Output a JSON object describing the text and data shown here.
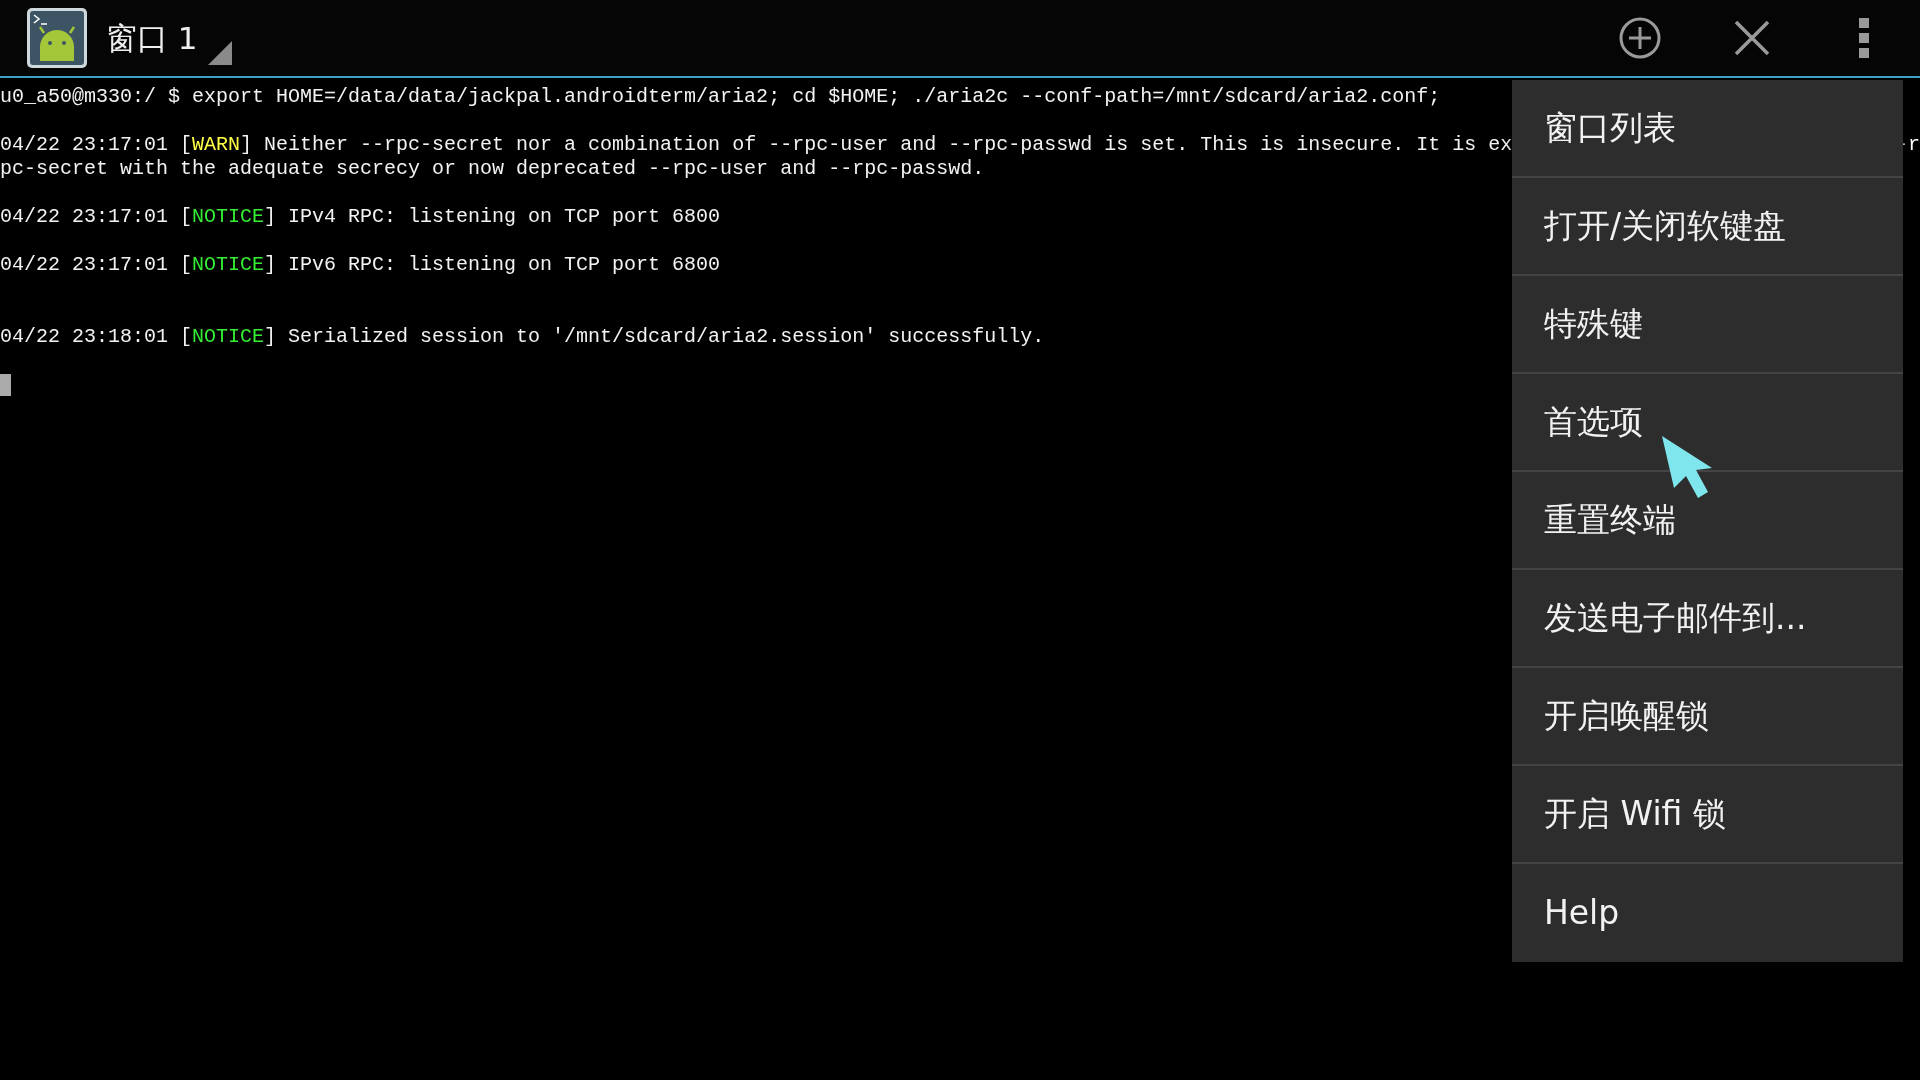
{
  "action_bar": {
    "window_title": "窗口 1",
    "actions": [
      {
        "kind": "add"
      },
      {
        "kind": "close"
      },
      {
        "kind": "overflow"
      }
    ]
  },
  "terminal": {
    "lines": [
      {
        "kind": "text",
        "segments": [
          {
            "kind": "plain",
            "text": "u0_a50@m330:/ $ export HOME=/data/data/jackpal.androidterm/aria2; cd $HOME; ./aria2c --conf-path=/mnt/sdcard/aria2.conf;"
          }
        ]
      },
      {
        "kind": "blank"
      },
      {
        "kind": "text",
        "segments": [
          {
            "kind": "plain",
            "text": "04/22 23:17:01 ["
          },
          {
            "kind": "warn",
            "text": "WARN"
          },
          {
            "kind": "plain",
            "text": "] Neither --rpc-secret nor a combination of --rpc-user and --rpc-passwd is set. This is insecure. It is ex"
          }
        ],
        "tail": "-r"
      },
      {
        "kind": "text",
        "segments": [
          {
            "kind": "plain",
            "text": "pc-secret with the adequate secrecy or now deprecated --rpc-user and --rpc-passwd."
          }
        ]
      },
      {
        "kind": "blank"
      },
      {
        "kind": "text",
        "segments": [
          {
            "kind": "plain",
            "text": "04/22 23:17:01 ["
          },
          {
            "kind": "notice",
            "text": "NOTICE"
          },
          {
            "kind": "plain",
            "text": "] IPv4 RPC: listening on TCP port 6800"
          }
        ]
      },
      {
        "kind": "blank"
      },
      {
        "kind": "text",
        "segments": [
          {
            "kind": "plain",
            "text": "04/22 23:17:01 ["
          },
          {
            "kind": "notice",
            "text": "NOTICE"
          },
          {
            "kind": "plain",
            "text": "] IPv6 RPC: listening on TCP port 6800"
          }
        ]
      },
      {
        "kind": "blank"
      },
      {
        "kind": "blank"
      },
      {
        "kind": "text",
        "segments": [
          {
            "kind": "plain",
            "text": "04/22 23:18:01 ["
          },
          {
            "kind": "notice",
            "text": "NOTICE"
          },
          {
            "kind": "plain",
            "text": "] Serialized session to '/mnt/sdcard/aria2.session' successfully."
          }
        ]
      },
      {
        "kind": "blank"
      },
      {
        "kind": "cursor"
      }
    ]
  },
  "menu": {
    "items": [
      {
        "label": "窗口列表"
      },
      {
        "label": "打开/关闭软键盘"
      },
      {
        "label": "特殊键"
      },
      {
        "label": "首选项"
      },
      {
        "label": "重置终端"
      },
      {
        "label": "发送电子邮件到..."
      },
      {
        "label": "开启唤醒锁"
      },
      {
        "label": "开启 Wifi 锁"
      },
      {
        "label": "Help"
      }
    ]
  },
  "pointer": {
    "kind": "arrow"
  }
}
